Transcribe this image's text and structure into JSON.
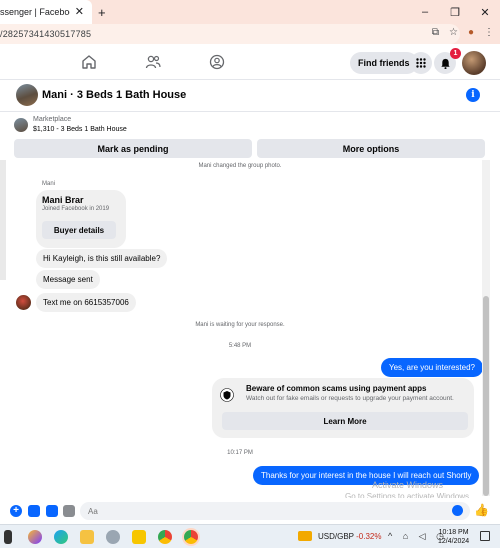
{
  "browser": {
    "tab_title": "ssenger | Facebook",
    "tab_close": "✕",
    "new_tab": "+",
    "url": "/28257341430517785",
    "window_controls": [
      "–",
      "❐",
      "✕"
    ]
  },
  "nav": {
    "find_friends": "Find friends",
    "notification_count": "1"
  },
  "chat": {
    "title": "Mani · 3 Beds 1 Bath House",
    "info": "i"
  },
  "marketplace": {
    "label": "Marketplace",
    "listing": "$1,310 - 3 Beds 1 Bath House",
    "mark_pending": "Mark as pending",
    "more_options": "More options"
  },
  "messages": {
    "system_photo": "Mani changed the group photo.",
    "sender": "Mani",
    "profile_name": "Mani Brar",
    "profile_sub": "Joined Facebook in 2019",
    "buyer_details": "Buyer details",
    "msg1": "Hi Kayleigh, is this still available?",
    "msg2": "Message sent",
    "msg3": "Text me on 6615357006",
    "waiting": "Mani is waiting for your response.",
    "time1": "5:48 PM",
    "out1": "Yes, are you interested?",
    "scam_title": "Beware of common scams using payment apps",
    "scam_sub": "Watch out for fake emails or requests to upgrade your payment account.",
    "learn_more": "Learn More",
    "time2": "10:17 PM",
    "out2": "Thanks for your interest in the house I will reach out Shortly",
    "watermark1": "Activate Windows",
    "watermark2": "Go to Settings to activate Windows."
  },
  "composer": {
    "placeholder": "Aa"
  },
  "taskbar": {
    "currency": "USD/GBP",
    "change": "-0.32%",
    "time": "10:18 PM",
    "date": "12/4/2024"
  },
  "colors": {
    "accent": "#0866ff",
    "badge": "#e41e3f",
    "chrome": "#fbe4dc"
  }
}
